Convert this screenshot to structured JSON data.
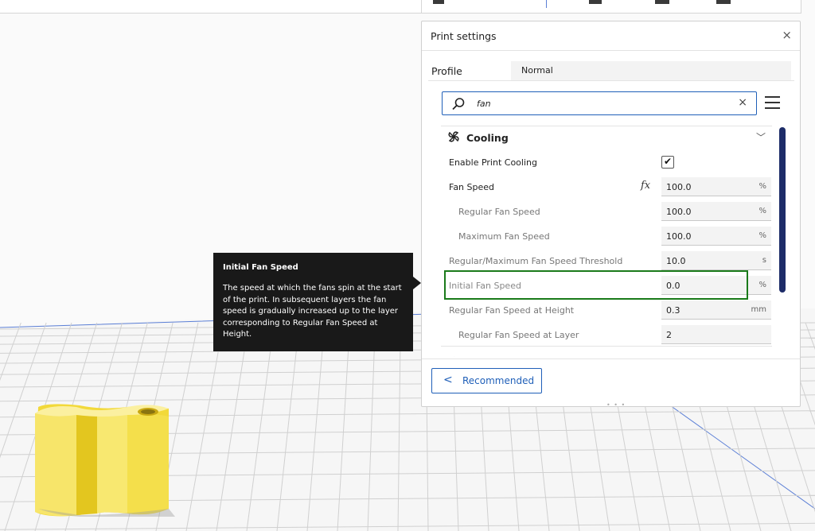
{
  "print_settings": {
    "title": "Print settings",
    "close_glyph": "×",
    "profile_label": "Profile",
    "profile_value": "Normal",
    "search": {
      "value": "fan",
      "clear_glyph": "×"
    },
    "category": {
      "title": "Cooling",
      "chevron": "﹀"
    },
    "rows": [
      {
        "label": "Enable Print Cooling",
        "checked": true,
        "check_glyph": "✔"
      },
      {
        "label": "Fan Speed",
        "value": "100.0",
        "unit": "%",
        "fx": "fx"
      },
      {
        "label": "Regular Fan Speed",
        "value": "100.0",
        "unit": "%"
      },
      {
        "label": "Maximum Fan Speed",
        "value": "100.0",
        "unit": "%"
      },
      {
        "label": "Regular/Maximum Fan Speed Threshold",
        "value": "10.0",
        "unit": "s"
      },
      {
        "label": "Initial Fan Speed",
        "value": "0.0",
        "unit": "%"
      },
      {
        "label": "Regular Fan Speed at Height",
        "value": "0.3",
        "unit": "mm"
      },
      {
        "label": "Regular Fan Speed at Layer",
        "value": "2",
        "unit": ""
      }
    ],
    "recommended_label": "Recommended",
    "recommended_chevron": "<"
  },
  "tooltip": {
    "title": "Initial Fan Speed",
    "body": "The speed at which the fans spin at the start of the print. In subsequent layers the fan speed is gradually increased up to the layer corresponding to Regular Fan Speed at Height."
  },
  "colors": {
    "accent": "#1f5fb8",
    "highlight": "#1a7a1a",
    "model": "#f7e04b",
    "scrollbar": "#1d2c68",
    "tooltip_bg": "#191919"
  }
}
